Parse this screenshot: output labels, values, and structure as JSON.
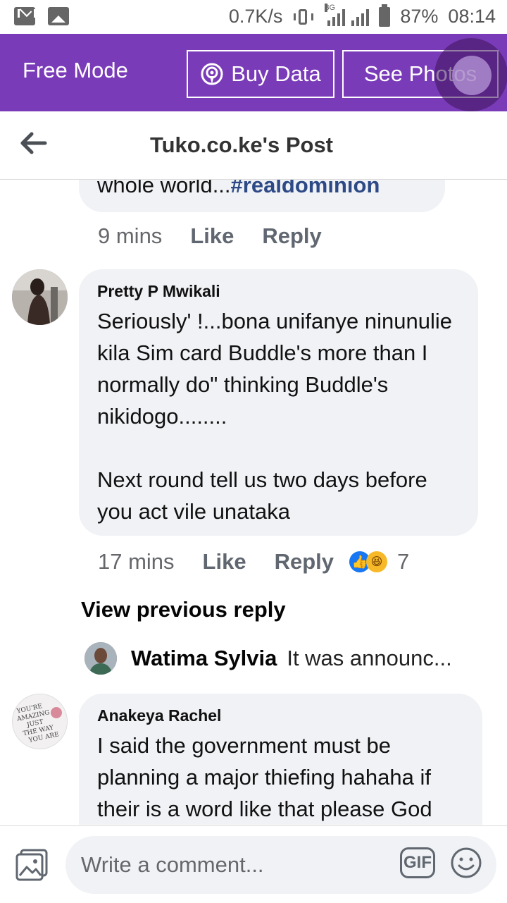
{
  "status_bar": {
    "speed": "0.7K/s",
    "network": "3G",
    "battery": "87%",
    "time": "08:14"
  },
  "free_bar": {
    "mode_label": "Free Mode",
    "buy_data_label": "Buy Data",
    "see_photos_label": "See Photos",
    "background": "#7a3bb9"
  },
  "header": {
    "title": "Tuko.co.ke's Post"
  },
  "comments": [
    {
      "text_prefix": "whole world...",
      "hashtag": "#realdominion",
      "time": "9 mins",
      "like_label": "Like",
      "reply_label": "Reply"
    },
    {
      "author": "Pretty P Mwikali",
      "text": "Seriously' !...bona unifanye ninunulie kila Sim card Buddle's more than I normally do\" thinking Buddle's nikidogo........\n\nNext round tell us two days before you act vile unataka",
      "time": "17 mins",
      "like_label": "Like",
      "reply_label": "Reply",
      "reaction_count": "7",
      "view_previous": "View previous reply",
      "reply_preview": {
        "author": "Watima Sylvia",
        "text": "It was announc..."
      }
    },
    {
      "author": "Anakeya Rachel",
      "avatar_text": "YOU'RE AMAZING JUST THE WAY YOU ARE",
      "text": "I said the government must be planning a major thiefing hahaha if their is a word like that please God"
    }
  ],
  "composer": {
    "placeholder": "Write a comment...",
    "gif_label": "GIF"
  }
}
